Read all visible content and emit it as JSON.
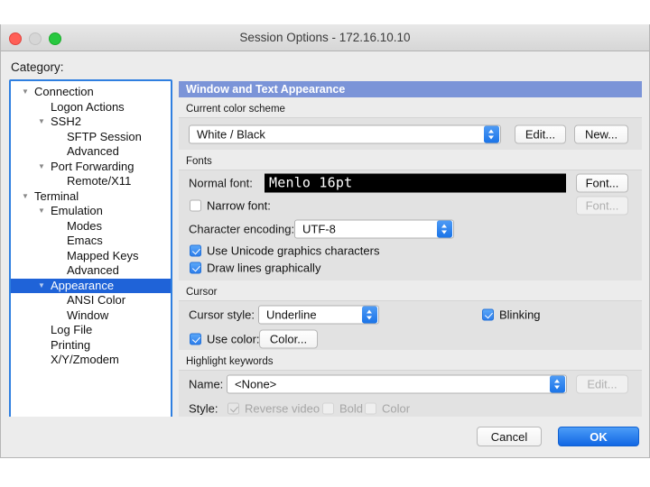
{
  "window": {
    "title": "Session Options - 172.16.10.10",
    "traffic": {
      "close": "close-button",
      "minimize": "minimize-button",
      "zoom": "zoom-button"
    }
  },
  "sidebar": {
    "label": "Category:",
    "items": [
      {
        "label": "Connection",
        "depth": 0,
        "triangle": "▼",
        "selected": false
      },
      {
        "label": "Logon Actions",
        "depth": 1,
        "triangle": "",
        "selected": false
      },
      {
        "label": "SSH2",
        "depth": 1,
        "triangle": "▼",
        "selected": false
      },
      {
        "label": "SFTP Session",
        "depth": 2,
        "triangle": "",
        "selected": false
      },
      {
        "label": "Advanced",
        "depth": 2,
        "triangle": "",
        "selected": false
      },
      {
        "label": "Port Forwarding",
        "depth": 1,
        "triangle": "▼",
        "selected": false
      },
      {
        "label": "Remote/X11",
        "depth": 2,
        "triangle": "",
        "selected": false
      },
      {
        "label": "Terminal",
        "depth": 0,
        "triangle": "▼",
        "selected": false
      },
      {
        "label": "Emulation",
        "depth": 1,
        "triangle": "▼",
        "selected": false
      },
      {
        "label": "Modes",
        "depth": 2,
        "triangle": "",
        "selected": false
      },
      {
        "label": "Emacs",
        "depth": 2,
        "triangle": "",
        "selected": false
      },
      {
        "label": "Mapped Keys",
        "depth": 2,
        "triangle": "",
        "selected": false
      },
      {
        "label": "Advanced",
        "depth": 2,
        "triangle": "",
        "selected": false
      },
      {
        "label": "Appearance",
        "depth": 1,
        "triangle": "▼",
        "selected": true
      },
      {
        "label": "ANSI Color",
        "depth": 2,
        "triangle": "",
        "selected": false
      },
      {
        "label": "Window",
        "depth": 2,
        "triangle": "",
        "selected": false
      },
      {
        "label": "Log File",
        "depth": 1,
        "triangle": "",
        "selected": false
      },
      {
        "label": "Printing",
        "depth": 1,
        "triangle": "",
        "selected": false
      },
      {
        "label": "X/Y/Zmodem",
        "depth": 1,
        "triangle": "",
        "selected": false
      }
    ]
  },
  "pane": {
    "header": "Window and Text Appearance",
    "color_scheme": {
      "group_label": "Current color scheme",
      "value": "White / Black",
      "edit_label": "Edit...",
      "new_label": "New..."
    },
    "fonts": {
      "group_label": "Fonts",
      "normal_font_label": "Normal font:",
      "normal_font_value": "Menlo 16pt",
      "normal_font_button": "Font...",
      "narrow_font_label": "Narrow font:",
      "narrow_font_checked": false,
      "narrow_font_button": "Font...",
      "encoding_label": "Character encoding:",
      "encoding_value": "UTF-8",
      "unicode_graphics_label": "Use Unicode graphics characters",
      "unicode_graphics_checked": true,
      "draw_lines_label": "Draw lines graphically",
      "draw_lines_checked": true
    },
    "cursor": {
      "group_label": "Cursor",
      "style_label": "Cursor style:",
      "style_value": "Underline",
      "blinking_label": "Blinking",
      "blinking_checked": true,
      "use_color_label": "Use color:",
      "use_color_checked": true,
      "color_button": "Color..."
    },
    "highlight": {
      "group_label": "Highlight keywords",
      "name_label": "Name:",
      "name_value": "<None>",
      "edit_label": "Edit...",
      "style_label": "Style:",
      "reverse_video_label": "Reverse video",
      "reverse_video_checked": true,
      "bold_label": "Bold",
      "bold_checked": false,
      "color_label": "Color",
      "color_checked": false
    }
  },
  "footer": {
    "cancel_label": "Cancel",
    "ok_label": "OK"
  },
  "colors": {
    "accent": "#1f63d8",
    "header_bar": "#7b94d8",
    "ok_button": "#1267e4",
    "tree_border": "#2f7fe0"
  }
}
